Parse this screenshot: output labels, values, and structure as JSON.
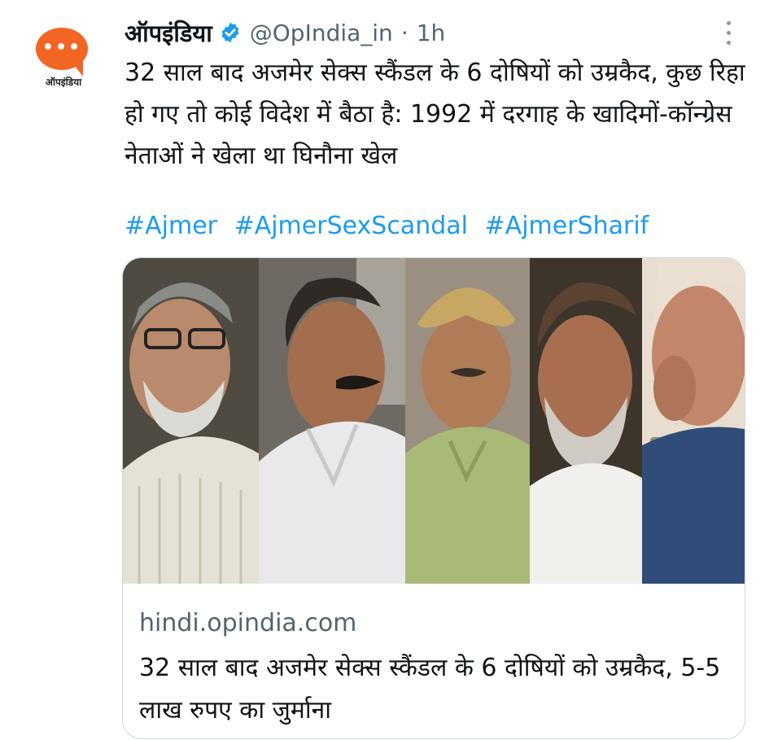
{
  "tweet": {
    "brand_logo_text": "ऑपइंडिया",
    "display_name": "ऑपइंडिया",
    "handle": "@OpIndia_in",
    "time_separator": "·",
    "time": "1h",
    "text": "32 साल बाद अजमेर सेक्स स्कैंडल के 6 दोषियों को उम्रकैद, कुछ रिहा हो गए तो कोई विदेश में बैठा है: 1992 में दरगाह के खादिमों-कॉन्ग्रेस नेताओं ने खेला था घिनौना खेल",
    "hashtags": [
      "#Ajmer",
      "#AjmerSexScandal",
      "#AjmerSharif"
    ]
  },
  "card": {
    "domain": "hindi.opindia.com",
    "title": "32 साल बाद अजमेर सेक्स स्कैंडल के 6 दोषियों को उम्रकैद, 5-5 लाख रुपए का जुर्माना"
  },
  "colors": {
    "brand_orange": "#f26522",
    "link_blue": "#1d9bf0",
    "verified_blue": "#1d9bf0",
    "secondary_text": "#536471"
  }
}
